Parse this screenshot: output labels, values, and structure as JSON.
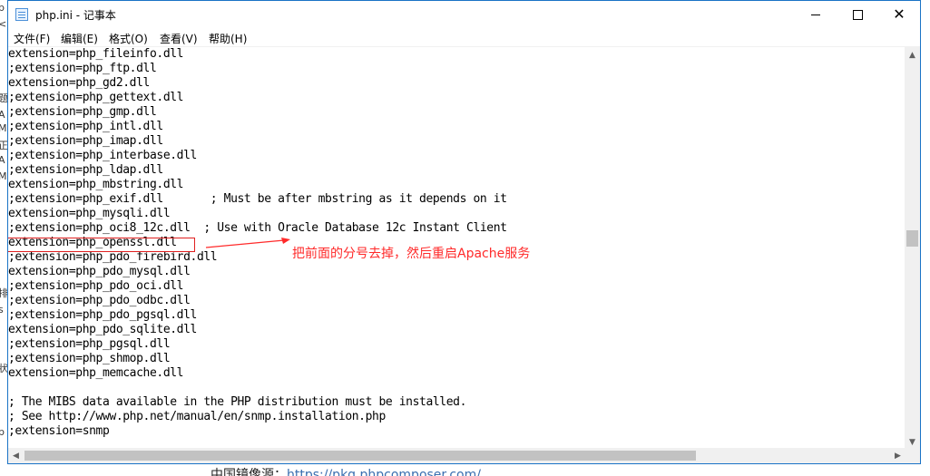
{
  "window": {
    "title": "php.ini - 记事本"
  },
  "menu": [
    {
      "label": "文件(F)"
    },
    {
      "label": "编辑(E)"
    },
    {
      "label": "格式(O)"
    },
    {
      "label": "查看(V)"
    },
    {
      "label": "帮助(H)"
    }
  ],
  "lines": [
    "extension=php_fileinfo.dll",
    ";extension=php_ftp.dll",
    "extension=php_gd2.dll",
    ";extension=php_gettext.dll",
    ";extension=php_gmp.dll",
    ";extension=php_intl.dll",
    ";extension=php_imap.dll",
    ";extension=php_interbase.dll",
    ";extension=php_ldap.dll",
    "extension=php_mbstring.dll",
    ";extension=php_exif.dll       ; Must be after mbstring as it depends on it",
    "extension=php_mysqli.dll",
    ";extension=php_oci8_12c.dll  ; Use with Oracle Database 12c Instant Client",
    "extension=php_openssl.dll",
    ";extension=php_pdo_firebird.dll",
    "extension=php_pdo_mysql.dll",
    ";extension=php_pdo_oci.dll",
    ";extension=php_pdo_odbc.dll",
    ";extension=php_pdo_pgsql.dll",
    "extension=php_pdo_sqlite.dll",
    ";extension=php_pgsql.dll",
    ";extension=php_shmop.dll",
    "extension=php_memcache.dll",
    "",
    "; The MIBS data available in the PHP distribution must be installed.",
    "; See http://www.php.net/manual/en/snmp.installation.php",
    ";extension=snmp"
  ],
  "annotation": {
    "text": "把前面的分号去掉，然后重启Apache服务",
    "color": "#ff2a2a"
  },
  "background": {
    "bottom_text": "中国镜像源：",
    "bottom_link": "https://pkg.phpcomposer.com/"
  },
  "colors": {
    "window_border": "#1a73c6",
    "highlight": "#e02020"
  }
}
